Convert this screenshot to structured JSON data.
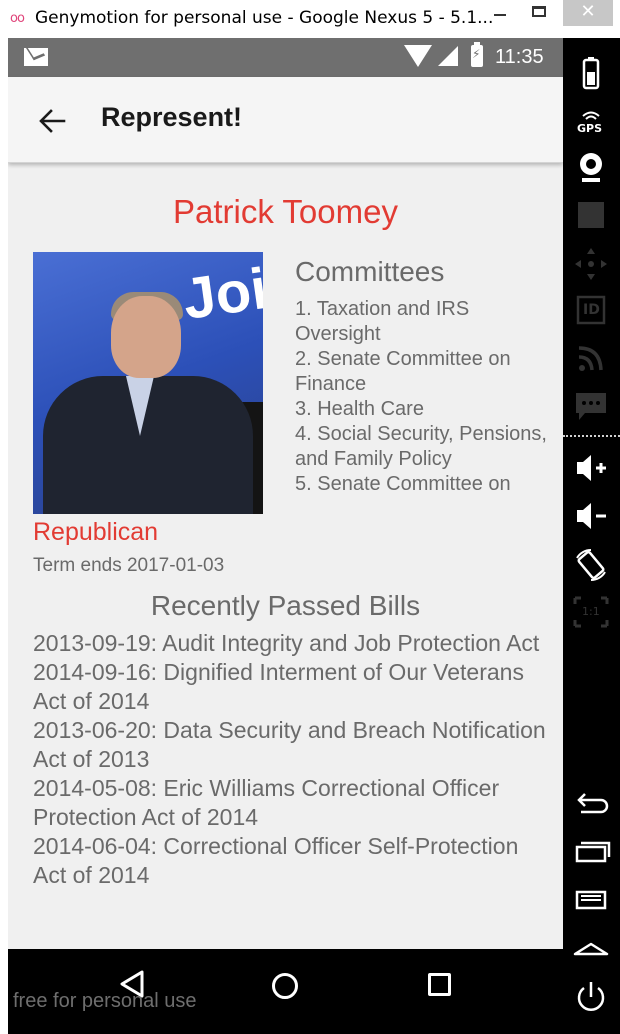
{
  "window": {
    "title": "Genymotion for personal use - Google Nexus 5 - 5.1...",
    "logo_text": "oo",
    "close_glyph": "✕"
  },
  "status_bar": {
    "time": "11:35",
    "icons": [
      "mail-icon",
      "wifi-icon",
      "signal-icon",
      "battery-icon"
    ]
  },
  "app_bar": {
    "title": "Represent!"
  },
  "representative": {
    "name": "Patrick Toomey",
    "photo_sign_text": "Join",
    "party": "Republican",
    "term": "Term ends 2017-01-03"
  },
  "committees": {
    "title": "Committees",
    "items": [
      "1. Taxation and IRS Oversight",
      "2. Senate Committee on Finance",
      "3. Health Care",
      "4. Social Security, Pensions, and Family Policy",
      "5. Senate Committee on"
    ]
  },
  "bills": {
    "title": "Recently Passed Bills",
    "items": [
      "2013-09-19: Audit Integrity and Job Protection Act",
      "2014-09-16: Dignified Interment of Our Veterans Act of 2014",
      "2013-06-20: Data Security and Breach Notification Act of 2013",
      "2014-05-08: Eric Williams Correctional Officer Protection Act of 2014",
      "2014-06-04: Correctional Officer Self-Protection Act of 2014"
    ]
  },
  "nav_bar": {
    "icons": [
      "back-triangle-icon",
      "home-circle-icon",
      "recents-square-icon"
    ]
  },
  "watermark": "free for personal use",
  "sidebar": {
    "icons": [
      "battery-icon",
      "gps-icon",
      "webcam-icon",
      "video-capture-icon",
      "dpad-icon",
      "id-icon",
      "rss-icon",
      "sms-icon",
      "volume-up-icon",
      "volume-down-icon",
      "rotate-icon",
      "scale-icon",
      "back-icon",
      "recents-icon",
      "menu-icon",
      "home-icon",
      "power-icon"
    ],
    "gps_label": "GPS",
    "id_label": "ID",
    "scale_label": "1:1"
  },
  "colors": {
    "accent_red": "#e23b33",
    "text_gray": "#6a6a6a",
    "status_bar": "#6f6f6f",
    "background": "#f0f0f0"
  }
}
